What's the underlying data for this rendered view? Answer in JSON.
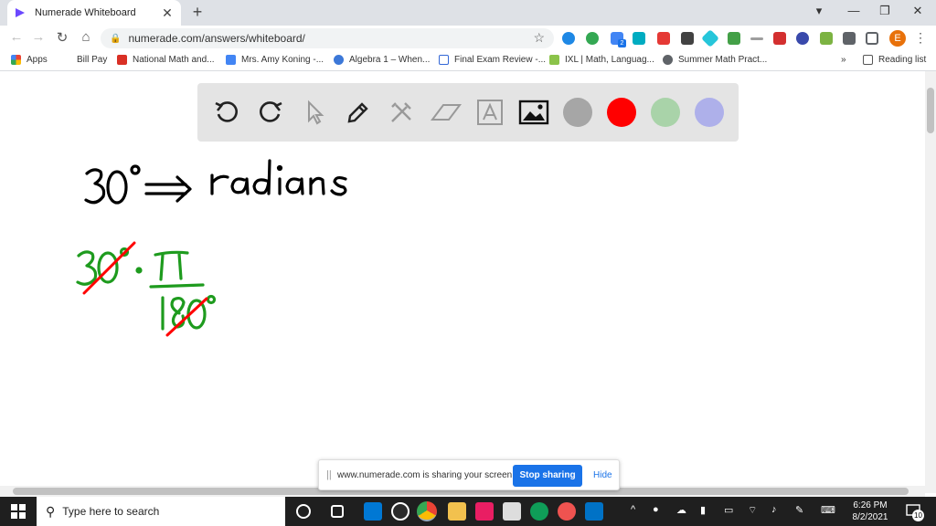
{
  "browser": {
    "tab": {
      "title": "Numerade Whiteboard",
      "close": "✕"
    },
    "new_tab": "+",
    "window_controls": [
      "▾",
      "—",
      "❐",
      "✕"
    ],
    "address": "numerade.com/answers/whiteboard/",
    "extension_badge": "2",
    "profile_initial": "E",
    "bookmarks": [
      {
        "label": "Apps",
        "color": "#ea4335"
      },
      {
        "label": "Bill Pay",
        "color": "#ffffff"
      },
      {
        "label": "National Math and...",
        "color": "#d93025"
      },
      {
        "label": "Mrs. Amy Koning -...",
        "color": "#4285f4"
      },
      {
        "label": "Algebra 1 – When...",
        "color": "#3c78d8"
      },
      {
        "label": "Final Exam Review -...",
        "color": "#3367d6"
      },
      {
        "label": "IXL | Math, Languag...",
        "color": "#8bc34a"
      },
      {
        "label": "Summer Math Pract...",
        "color": "#5f6368"
      }
    ],
    "bookmarks_more": "»",
    "reading_list": "Reading list"
  },
  "whiteboard": {
    "tools": [
      "undo-icon",
      "redo-icon",
      "pointer-icon",
      "pen-icon",
      "tools-icon",
      "eraser-icon",
      "text-icon",
      "image-icon"
    ],
    "colors": [
      "#a6a6a6",
      "#ff0000",
      "#a9d3a9",
      "#aeb0ea"
    ]
  },
  "share_bar": {
    "message": "www.numerade.com is sharing your screen.",
    "stop_label": "Stop sharing",
    "hide_label": "Hide"
  },
  "taskbar": {
    "search_placeholder": "Type here to search",
    "time": "6:26 PM",
    "date": "8/2/2021",
    "notifications": "10"
  }
}
